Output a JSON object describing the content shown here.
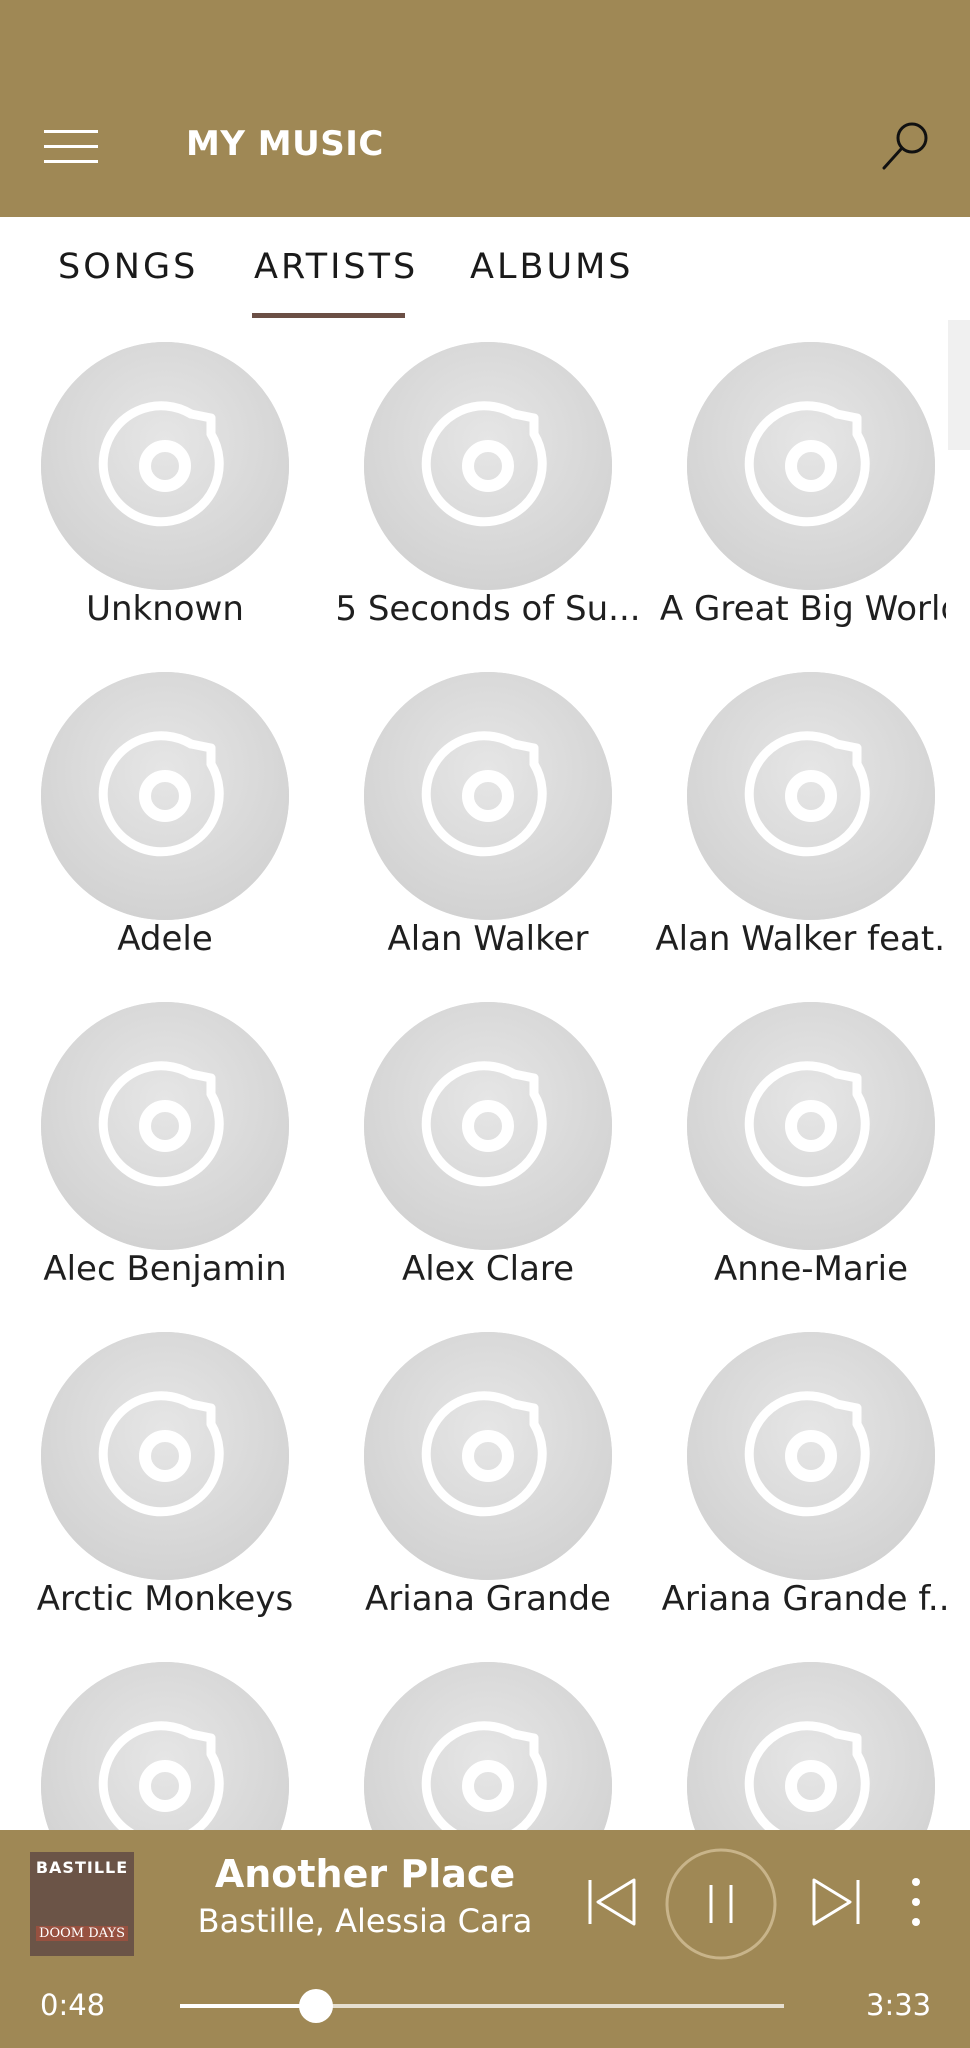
{
  "header": {
    "title": "MY MUSIC",
    "menu_icon": "hamburger-icon",
    "search_icon": "search-icon",
    "color": "#9f8855"
  },
  "tabs": [
    {
      "label": "SONGS",
      "selected": false
    },
    {
      "label": "ARTISTS",
      "selected": true
    },
    {
      "label": "ALBUMS",
      "selected": false
    }
  ],
  "artists": [
    "Unknown",
    "5 Seconds of Su...",
    "A Great Big World",
    "Adele",
    "Alan Walker",
    "Alan Walker feat...",
    "Alec Benjamin",
    "Alex Clare",
    "Anne-Marie",
    "Arctic Monkeys",
    "Ariana Grande",
    "Ariana Grande f...",
    "",
    "",
    ""
  ],
  "placeholder_icon": "disc-icon",
  "player": {
    "album_art_text_top": "BASTILLE",
    "album_art_text_bottom": "DOOM DAYS",
    "song_title": "Another Place",
    "song_artists": "Bastille, Alessia Cara",
    "elapsed": "0:48",
    "duration": "3:33",
    "progress_fraction": 0.225,
    "icons": [
      "previous-icon",
      "pause-icon",
      "next-icon",
      "more-icon"
    ]
  }
}
